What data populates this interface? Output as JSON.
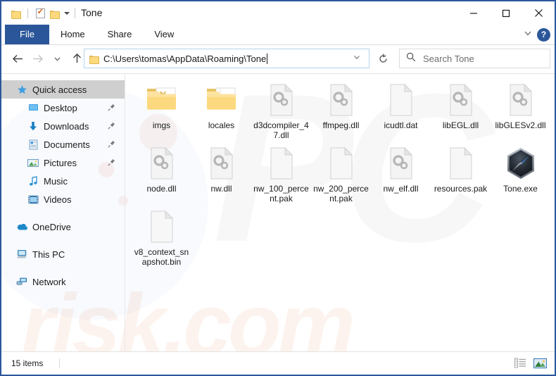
{
  "window": {
    "title": "Tone",
    "quick_access_toolbar": [
      {
        "name": "folder-icon",
        "label": "Folder"
      },
      {
        "name": "properties-icon",
        "label": "Properties"
      },
      {
        "name": "new-folder-icon",
        "label": "New folder"
      },
      {
        "name": "customize-caret-icon",
        "label": "Customize Quick Access Toolbar"
      }
    ],
    "controls": {
      "minimize": "Minimize",
      "maximize": "Maximize",
      "close": "Close"
    }
  },
  "ribbon": {
    "tabs": [
      {
        "label": "File",
        "active": true
      },
      {
        "label": "Home",
        "active": false
      },
      {
        "label": "Share",
        "active": false
      },
      {
        "label": "View",
        "active": false
      }
    ],
    "expand_label": "Expand the Ribbon",
    "help_label": "?"
  },
  "navigation": {
    "back": "Back",
    "forward": "Forward",
    "recent": "Recent locations",
    "up": "Up"
  },
  "address": {
    "path": "C:\\Users\\tomas\\AppData\\Roaming\\Tone",
    "dropdown": "Previous locations",
    "refresh": "Refresh"
  },
  "search": {
    "placeholder": "Search Tone"
  },
  "sidebar": {
    "items": [
      {
        "label": "Quick access",
        "icon": "star-icon",
        "level": 0,
        "selected": true,
        "pinned": false
      },
      {
        "label": "Desktop",
        "icon": "desktop-icon",
        "level": 1,
        "selected": false,
        "pinned": true
      },
      {
        "label": "Downloads",
        "icon": "downloads-icon",
        "level": 1,
        "selected": false,
        "pinned": true
      },
      {
        "label": "Documents",
        "icon": "documents-icon",
        "level": 1,
        "selected": false,
        "pinned": true
      },
      {
        "label": "Pictures",
        "icon": "pictures-icon",
        "level": 1,
        "selected": false,
        "pinned": true
      },
      {
        "label": "Music",
        "icon": "music-icon",
        "level": 1,
        "selected": false,
        "pinned": false
      },
      {
        "label": "Videos",
        "icon": "videos-icon",
        "level": 1,
        "selected": false,
        "pinned": false
      },
      {
        "label": "OneDrive",
        "icon": "onedrive-icon",
        "level": 0,
        "selected": false,
        "pinned": false,
        "gap_before": true
      },
      {
        "label": "This PC",
        "icon": "this-pc-icon",
        "level": 0,
        "selected": false,
        "pinned": false,
        "gap_before": true
      },
      {
        "label": "Network",
        "icon": "network-icon",
        "level": 0,
        "selected": false,
        "pinned": false,
        "gap_before": true
      }
    ]
  },
  "files": [
    {
      "name": "imgs",
      "icon": "folder-images-icon",
      "type": "folder"
    },
    {
      "name": "locales",
      "icon": "folder-icon",
      "type": "folder"
    },
    {
      "name": "d3dcompiler_47.dll",
      "icon": "dll-file-icon",
      "type": "dll"
    },
    {
      "name": "ffmpeg.dll",
      "icon": "dll-file-icon",
      "type": "dll"
    },
    {
      "name": "icudtl.dat",
      "icon": "generic-file-icon",
      "type": "file"
    },
    {
      "name": "libEGL.dll",
      "icon": "dll-file-icon",
      "type": "dll"
    },
    {
      "name": "libGLESv2.dll",
      "icon": "dll-file-icon",
      "type": "dll"
    },
    {
      "name": "node.dll",
      "icon": "dll-file-icon",
      "type": "dll"
    },
    {
      "name": "nw.dll",
      "icon": "dll-file-icon",
      "type": "dll"
    },
    {
      "name": "nw_100_percent.pak",
      "icon": "generic-file-icon",
      "type": "file"
    },
    {
      "name": "nw_200_percent.pak",
      "icon": "generic-file-icon",
      "type": "file"
    },
    {
      "name": "nw_elf.dll",
      "icon": "dll-file-icon",
      "type": "dll"
    },
    {
      "name": "resources.pak",
      "icon": "generic-file-icon",
      "type": "file"
    },
    {
      "name": "Tone.exe",
      "icon": "tone-app-icon",
      "type": "exe"
    },
    {
      "name": "v8_context_snapshot.bin",
      "icon": "generic-file-icon",
      "type": "file"
    }
  ],
  "statusbar": {
    "item_count": "15 items",
    "details_view": "Details view",
    "large_icons_view": "Large icons view"
  },
  "watermarks": {
    "background_letters": "PC",
    "site": "risk.com"
  },
  "colors": {
    "accent": "#2b579a",
    "window_border": "#2b579a",
    "selection": "#cfcfcf",
    "folder": "#fbd97c",
    "text": "#1a1a1a"
  }
}
